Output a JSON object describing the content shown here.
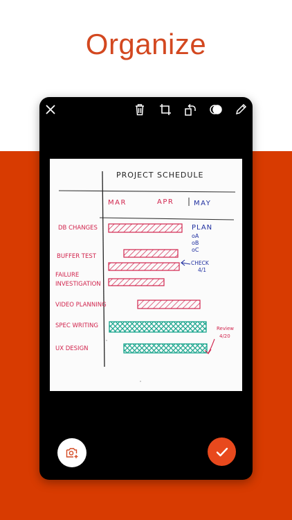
{
  "headline": "Organize",
  "colors": {
    "accent": "#d83b01",
    "headline": "#d34820",
    "done_button": "#e8491d",
    "bar_red": "#d1234c",
    "bar_green": "#1aa58d",
    "ink_blue": "#1f2fa0"
  },
  "toolbar": {
    "icons": [
      "close-icon",
      "delete-icon",
      "crop-icon",
      "rotate-icon",
      "filter-icon",
      "pen-icon"
    ]
  },
  "document": {
    "title": "PROJECT SCHEDULE",
    "months": [
      "MAR",
      "APR",
      "MAY"
    ],
    "tasks": [
      "DB CHANGES",
      "BUFFER TEST",
      "FAILURE",
      "INVESTIGATION",
      "VIDEO PLANNING",
      "SPEC WRITING",
      "UX DESIGN"
    ],
    "notes": {
      "plan": "PLAN",
      "plan_a": "oA",
      "plan_b": "oB",
      "plan_c": "oC",
      "check": "CHECK",
      "check_date": "4/1",
      "review": "Review",
      "review_date": "4/20"
    }
  },
  "actions": {
    "camera_icon": "camera-add-icon",
    "done_icon": "checkmark-icon"
  }
}
